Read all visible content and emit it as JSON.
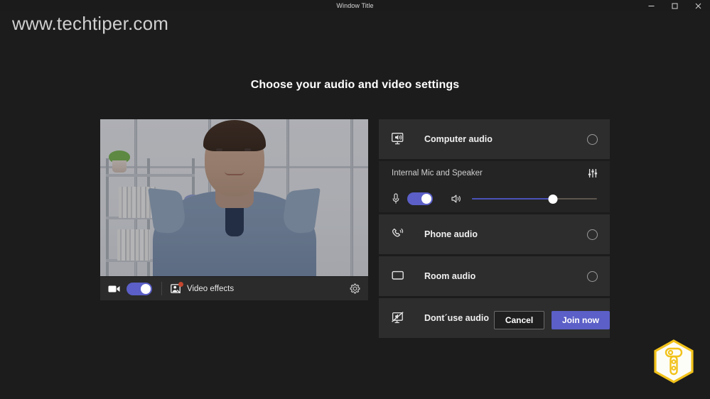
{
  "window": {
    "title": "Window Title",
    "controls": [
      {
        "name": "minimize-button",
        "label": "Minimize"
      },
      {
        "name": "maximize-button",
        "label": "Maximize"
      },
      {
        "name": "close-button",
        "label": "Close"
      }
    ]
  },
  "watermark": {
    "text": "www.techtiper.com"
  },
  "page": {
    "heading": "Choose your audio and video settings",
    "background_color": "#1c1c1c",
    "accent_color": "#5b5fc7"
  },
  "video": {
    "preview_alt": "Camera preview of a man in a light blue shirt in a bright office",
    "camera_toggle": {
      "label": "Camera",
      "state": "on"
    },
    "effects": {
      "icon": "video-effects-icon",
      "label": "Video effects",
      "badge": true
    },
    "settings": {
      "icon": "gear-icon",
      "label": "Device settings"
    }
  },
  "audio": {
    "options": [
      {
        "id": "computer-audio",
        "icon": "computer-speaker-icon",
        "label": "Computer audio",
        "selected": false
      },
      {
        "id": "phone-audio",
        "icon": "phone-ring-icon",
        "label": "Phone audio",
        "selected": false
      },
      {
        "id": "room-audio",
        "icon": "monitor-icon",
        "label": "Room audio",
        "selected": false
      },
      {
        "id": "no-audio",
        "icon": "monitor-muted-icon",
        "label": "Dont´use audio",
        "selected": false
      }
    ],
    "device": {
      "name": "Internal Mic and Speaker",
      "settings_icon": "sliders-icon",
      "mic_toggle": {
        "icon": "microphone-icon",
        "state": "on"
      },
      "volume": {
        "icon": "speaker-icon",
        "value": 65,
        "min": 0,
        "max": 100
      }
    }
  },
  "footer": {
    "cancel_label": "Cancel",
    "join_label": "Join now"
  },
  "logo": {
    "name": "techtiper-logo",
    "color": "#f2c21a"
  }
}
